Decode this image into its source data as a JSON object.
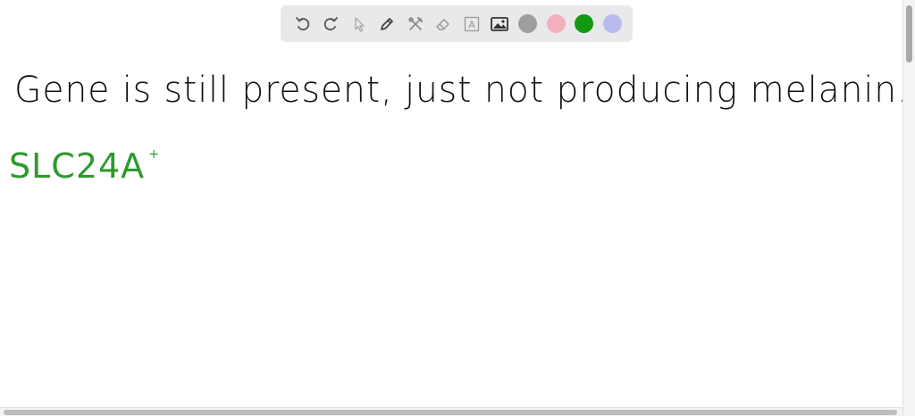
{
  "toolbar": {
    "tools": [
      {
        "name": "undo-icon"
      },
      {
        "name": "redo-icon"
      },
      {
        "name": "pointer-icon"
      },
      {
        "name": "pencil-icon"
      },
      {
        "name": "tools-icon"
      },
      {
        "name": "eraser-icon"
      },
      {
        "name": "text-icon",
        "glyph": "A"
      },
      {
        "name": "image-icon"
      }
    ],
    "colors": [
      {
        "name": "gray",
        "hex": "#9e9e9e"
      },
      {
        "name": "pink",
        "hex": "#f2b2bd"
      },
      {
        "name": "green",
        "hex": "#119a11"
      },
      {
        "name": "lavender",
        "hex": "#b8b9ec"
      }
    ]
  },
  "canvas": {
    "line1": "Gene is still present, just not producing melanin.",
    "line2_main": "SLC24A",
    "line2_sup": "+",
    "ink_colors": {
      "black": "#111111",
      "green": "#2c9a2c"
    }
  }
}
